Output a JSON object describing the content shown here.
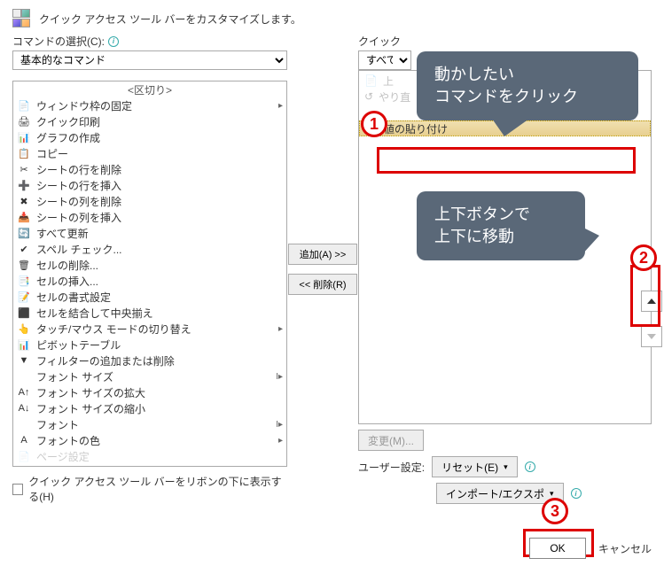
{
  "header": {
    "title": "クイック アクセス ツール バーをカスタマイズします。"
  },
  "left": {
    "label": "コマンドの選択(C):",
    "combo": "基本的なコマンド",
    "items": [
      {
        "ico": "",
        "label": "<区切り>",
        "sep": true
      },
      {
        "ico": "📄",
        "label": "ウィンドウ枠の固定",
        "sub": "▸"
      },
      {
        "ico": "🖨",
        "label": "クイック印刷"
      },
      {
        "ico": "📊",
        "label": "グラフの作成"
      },
      {
        "ico": "📋",
        "label": "コピー"
      },
      {
        "ico": "✂",
        "label": "シートの行を削除"
      },
      {
        "ico": "➕",
        "label": "シートの行を挿入"
      },
      {
        "ico": "✖",
        "label": "シートの列を削除"
      },
      {
        "ico": "📥",
        "label": "シートの列を挿入"
      },
      {
        "ico": "🔄",
        "label": "すべて更新"
      },
      {
        "ico": "✔",
        "label": "スペル チェック..."
      },
      {
        "ico": "🗑",
        "label": "セルの削除..."
      },
      {
        "ico": "📑",
        "label": "セルの挿入..."
      },
      {
        "ico": "📝",
        "label": "セルの書式設定"
      },
      {
        "ico": "⬛",
        "label": "セルを結合して中央揃え"
      },
      {
        "ico": "👆",
        "label": "タッチ/マウス モードの切り替え",
        "sub": "▸"
      },
      {
        "ico": "📊",
        "label": "ピボットテーブル"
      },
      {
        "ico": "▼",
        "label": "フィルターの追加または削除"
      },
      {
        "ico": "",
        "label": "フォント サイズ",
        "sub": "I▸"
      },
      {
        "ico": "A↑",
        "label": "フォント サイズの拡大"
      },
      {
        "ico": "A↓",
        "label": "フォント サイズの縮小"
      },
      {
        "ico": "",
        "label": "フォント",
        "sub": "I▸"
      },
      {
        "ico": "A",
        "label": "フォントの色",
        "sub": "▸"
      },
      {
        "ico": "📄",
        "label": "ページ設定",
        "hidden": true
      }
    ],
    "checkbox": "クイック アクセス ツール バーをリボンの下に表示する(H)"
  },
  "mid": {
    "add": "追加(A) >>",
    "remove": "<< 削除(R)"
  },
  "right": {
    "label": "クイック",
    "combo": "すべて",
    "hidden1": "上",
    "hidden2": "やり直",
    "selected": {
      "ico": "📋",
      "label": "値の貼り付け"
    },
    "modify": "変更(M)...",
    "user_label": "ユーザー設定:",
    "reset": "リセット(E)",
    "import": "インポート/エクスポ"
  },
  "callouts": {
    "c1a": "動かしたい",
    "c1b": "コマンドをクリック",
    "c2a": "上下ボタンで",
    "c2b": "上下に移動"
  },
  "footer": {
    "ok": "OK",
    "cancel": "キャンセル"
  }
}
